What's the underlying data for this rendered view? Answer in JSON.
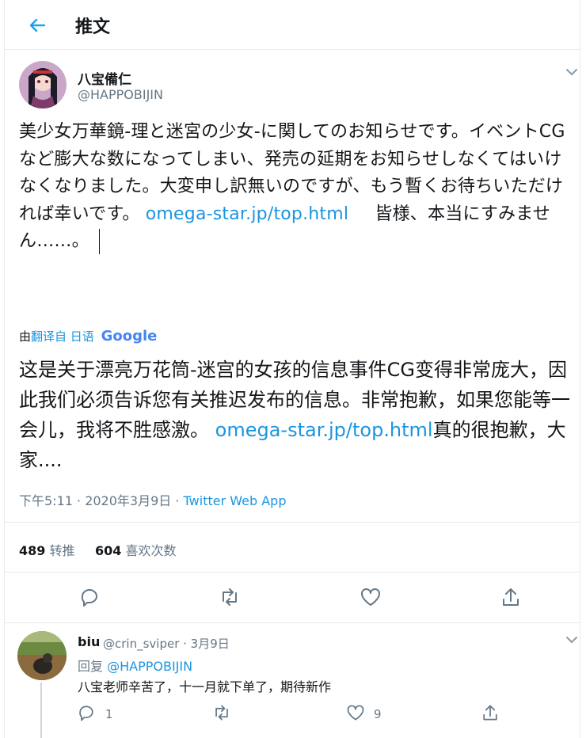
{
  "header": {
    "title": "推文"
  },
  "tweet": {
    "name": "八宝備仁",
    "handle": "@HAPPOBIJIN",
    "text_part1": "美少女万華鏡-理と迷宮の少女-に関してのお知らせです。イベントCGなど膨大な数になってしまい、発売の延期をお知らせしなくてはいけなくなりました。大変申し訳無いのですが、もう暫くお待ちいただければ幸いです。",
    "link": "omega-star.jp/top.html",
    "text_part2": "皆様、本当にすみません……。",
    "translated_prefix": "由",
    "translated_lang": "翻译自 日语",
    "translated_engine": "Google",
    "translation_part1": "这是关于漂亮万花筒-迷宫的女孩的信息事件CG变得非常庞大，因此我们必须告诉您有关推迟发布的信息。非常抱歉，如果您能等一会儿，我将不胜感激。",
    "translation_link": "omega-star.jp/top.html",
    "translation_part2": "真的很抱歉，大家....",
    "time": "下午5:11 · 2020年3月9日 · ",
    "source": "Twitter Web App",
    "retweets": "489",
    "retweets_label": "转推",
    "likes": "604",
    "likes_label": "喜欢次数"
  },
  "reply": {
    "name": "biu",
    "handle": "@crin_sviper · 3月9日",
    "reply_prefix": "回复",
    "reply_to": "@HAPPOBIJIN",
    "text": "八宝老师辛苦了，十一月就下单了，期待新作",
    "reply_count": "1",
    "like_count": "9"
  },
  "colors": {
    "accent": "#1da1f2",
    "link": "#1b95e0",
    "muted": "#657786",
    "border": "#e6ecf0"
  },
  "icons": [
    "back-arrow-icon",
    "chevron-down-icon",
    "reply-icon",
    "retweet-icon",
    "like-icon",
    "share-icon"
  ]
}
